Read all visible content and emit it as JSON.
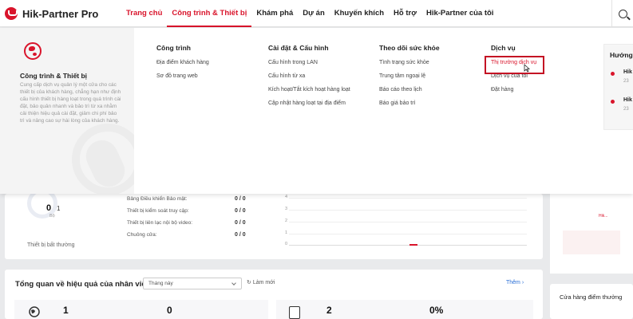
{
  "header": {
    "app_name": "Hik-Partner Pro",
    "nav": [
      {
        "label": "Trang chủ"
      },
      {
        "label": "Công trình & Thiết bị"
      },
      {
        "label": "Khám phá"
      },
      {
        "label": "Dự án"
      },
      {
        "label": "Khuyến khích"
      },
      {
        "label": "Hỗ trợ"
      },
      {
        "label": "Hik-Partner của tôi"
      }
    ],
    "search_icon": "search-icon"
  },
  "mega_menu": {
    "intro": {
      "title": "Công trình & Thiết bị",
      "description": "Cung cấp dịch vụ quản lý một cửa cho các thiết bị của khách hàng, chẳng hạn như định cấu hình thiết bị hàng loạt trong quá trình cài đặt, bảo quản nhanh và bảo trì từ xa nhằm cải thiện hiệu quả cài đặt, giảm chi phí bảo trì và nâng cao sự hài lòng của khách hàng."
    },
    "columns": [
      {
        "title": "Công trình",
        "items": [
          "Địa điểm khách hàng",
          "Sơ đồ trang web"
        ]
      },
      {
        "title": "Cài đặt & Cấu hình",
        "items": [
          "Cấu hình trong LAN",
          "Cấu hình từ xa",
          "Kích hoạt/Tắt kích hoạt hàng loạt",
          "Cập nhật hàng loạt tại địa điểm"
        ]
      },
      {
        "title": "Theo dõi sức khỏe",
        "items": [
          "Tình trạng sức khỏe",
          "Trung tâm ngoại lệ",
          "Báo cáo theo lịch",
          "Báo giá bảo trì"
        ]
      },
      {
        "title": "Dịch vụ",
        "items": [
          "Thị trường dịch vụ",
          "Dịch vụ của tôi",
          "Đặt hàng"
        ]
      }
    ],
    "news": {
      "title": "Hướng",
      "items": [
        {
          "title": "Hik",
          "date": "23"
        },
        {
          "title": "Hik",
          "date": "23"
        }
      ]
    }
  },
  "dashboard": {
    "device_status": {
      "count": "0",
      "total": "1",
      "unit": "Bộ",
      "label": "Thiết bị bất thường",
      "stats": [
        {
          "label": "Bảng Điều khiển Bảo mật:",
          "value": "0 / 0"
        },
        {
          "label": "Thiết bị kiểm soát truy cập:",
          "value": "0 / 0"
        },
        {
          "label": "Thiết bị liên lạc nội bộ video:",
          "value": "0 / 0"
        },
        {
          "label": "Chuông cửa:",
          "value": "0 / 0"
        }
      ]
    },
    "chart_axis": [
      "4",
      "3",
      "2",
      "1",
      "0"
    ],
    "staff": {
      "title": "Tổng quan về hiệu quả của nhân viên",
      "period": "Tháng này",
      "refresh": "Làm mới",
      "more": "Thêm",
      "metrics": [
        "1",
        "0",
        "2",
        "0%"
      ]
    },
    "side": {
      "store_title": "Cửa hàng điểm thưởng",
      "promo_text": "Hik..."
    }
  }
}
